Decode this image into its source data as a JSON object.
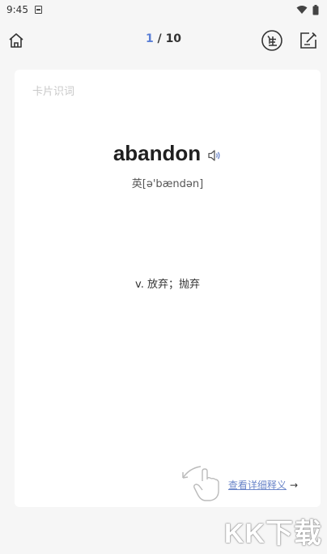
{
  "status_bar": {
    "time": "9:45"
  },
  "header": {
    "current_index": "1",
    "separator": " / ",
    "total": "10"
  },
  "card": {
    "title": "卡片识词",
    "word": "abandon",
    "phonetic": "英[ə'bændən]",
    "meaning": "v. 放弃；抛弃",
    "detail_link": "查看详细释义",
    "detail_arrow": "→"
  },
  "watermark": {
    "text": "KK下载"
  },
  "colors": {
    "accent": "#5b7fd6",
    "link": "#6b86c9",
    "background": "#f6f6f6",
    "card": "#ffffff"
  }
}
